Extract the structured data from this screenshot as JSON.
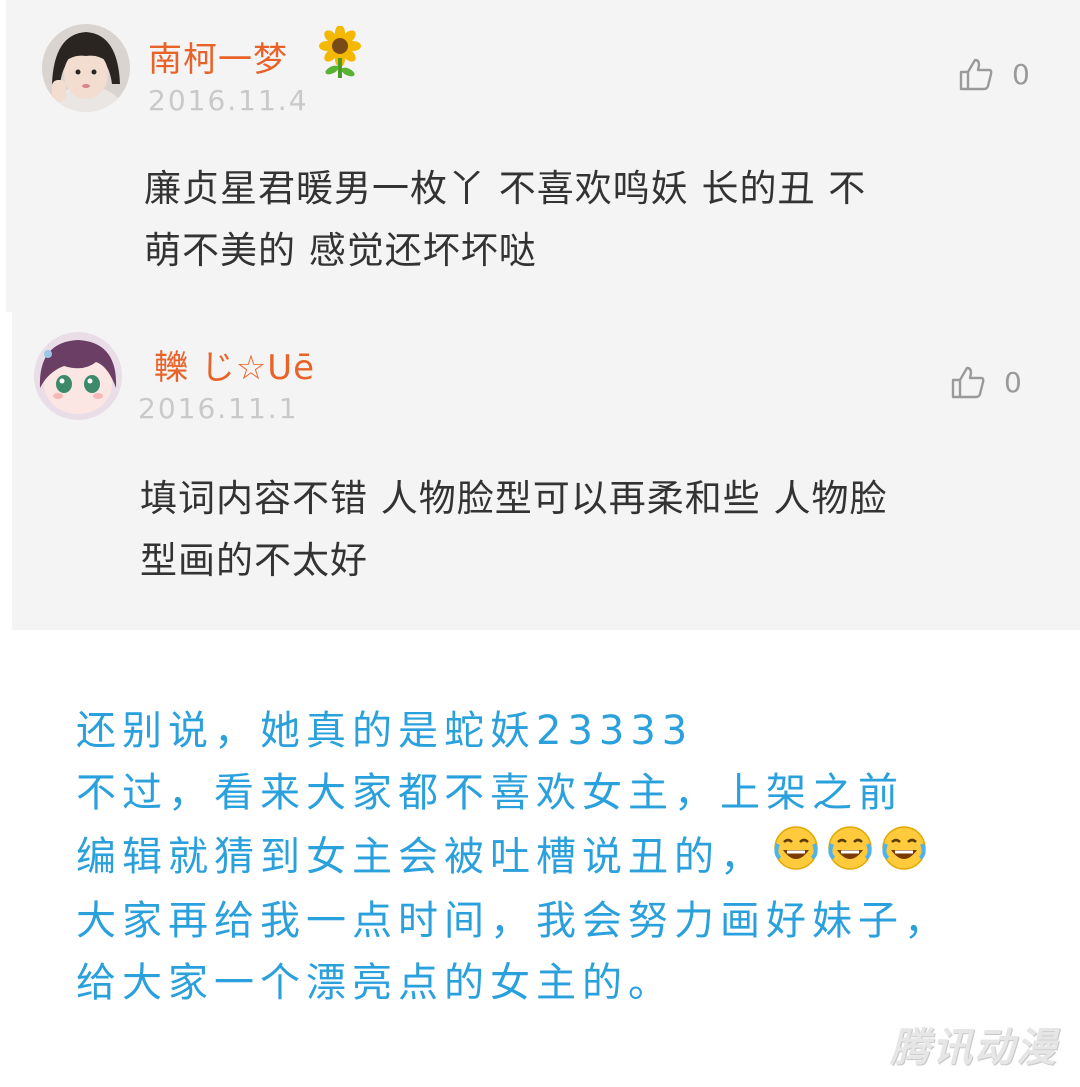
{
  "comments": [
    {
      "username": "南柯一梦",
      "badge_icon": "sunflower-icon",
      "date": "2016.11.4",
      "likes": "0",
      "lines": [
        "廉贞星君暖男一枚丫 不喜欢鸣妖 长的丑 不",
        "萌不美的 感觉还坏坏哒"
      ]
    },
    {
      "username": "轢 じ☆Uē",
      "date": "2016.11.1",
      "likes": "0",
      "lines": [
        "填词内容不错 人物脸型可以再柔和些 人物脸",
        "型画的不太好"
      ]
    }
  ],
  "author_reply": {
    "lines": [
      "还别说，她真的是蛇妖23333",
      "不过，看来大家都不喜欢女主，上架之前",
      "编辑就猜到女主会被吐槽说丑的，",
      "大家再给我一点时间，我会努力画好妹子，",
      "给大家一个漂亮点的女主的。"
    ],
    "emoji": [
      "laughing-crying-emoji",
      "laughing-crying-emoji",
      "laughing-crying-emoji"
    ],
    "color": "#2aa0dc"
  },
  "watermark": "腾讯动漫",
  "colors": {
    "username": "#e8632a",
    "date": "#c9c9c9",
    "card_bg": "#f4f4f4",
    "text": "#333333"
  }
}
